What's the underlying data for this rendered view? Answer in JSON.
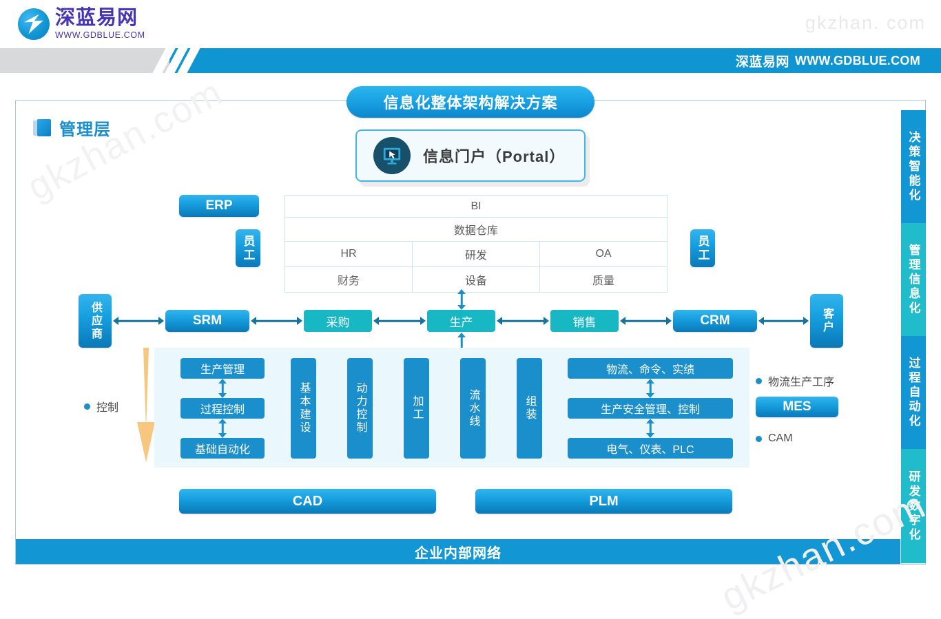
{
  "watermarks": {
    "top_right": "gkzhan. com",
    "bottom_left": "gkzhan.com",
    "bottom_right": "gkzhan.com"
  },
  "header": {
    "logo_cn": "深蓝易网",
    "logo_en": "WWW.GDBLUE.COM",
    "band_cn": "深蓝易网",
    "band_url": "WWW.GDBLUE.COM"
  },
  "diagram": {
    "title": "信息化整体架构解决方案",
    "layer_label": "管理层",
    "portal_label": "信息门户（Portal）",
    "erp_label": "ERP",
    "employee_left": "员工",
    "employee_right": "员工",
    "erp_table": {
      "row_bi": "BI",
      "row_dw": "数据仓库",
      "row3": [
        "HR",
        "研发",
        "OA"
      ],
      "row4": [
        "财务",
        "设备",
        "质量"
      ]
    },
    "chain": {
      "supplier": "供应商",
      "srm": "SRM",
      "purchase": "采购",
      "production": "生产",
      "sales": "销售",
      "crm": "CRM",
      "customer": "客户"
    },
    "control_legend": "控制",
    "mes_panel": {
      "stack_left": [
        "生产管理",
        "过程控制",
        "基础自动化"
      ],
      "pillars": [
        "基本建设",
        "动力控制",
        "加工",
        "流水线",
        "组装"
      ],
      "stack_right": [
        "物流、命令、实绩",
        "生产安全管理、控制",
        "电气、仪表、PLC"
      ]
    },
    "right_legend": {
      "item1": "物流生产工序",
      "mes": "MES",
      "item2": "CAM"
    },
    "cad": "CAD",
    "plm": "PLM",
    "network_bar": "企业内部网络",
    "sidebar": [
      {
        "label": "决策智能化",
        "color": "#1296d4"
      },
      {
        "label": "管理信息化",
        "color": "#21bccb"
      },
      {
        "label": "过程自动化",
        "color": "#1296d4"
      },
      {
        "label": "研发数字化",
        "color": "#21bccb"
      }
    ]
  },
  "colors": {
    "brand_blue": "#1296d4",
    "teal": "#17b7c4",
    "flat_blue": "#1b8fcb",
    "arrow_dark": "#14739f",
    "panel_bg": "#eaf7fc",
    "orange": "#f8c77f"
  }
}
